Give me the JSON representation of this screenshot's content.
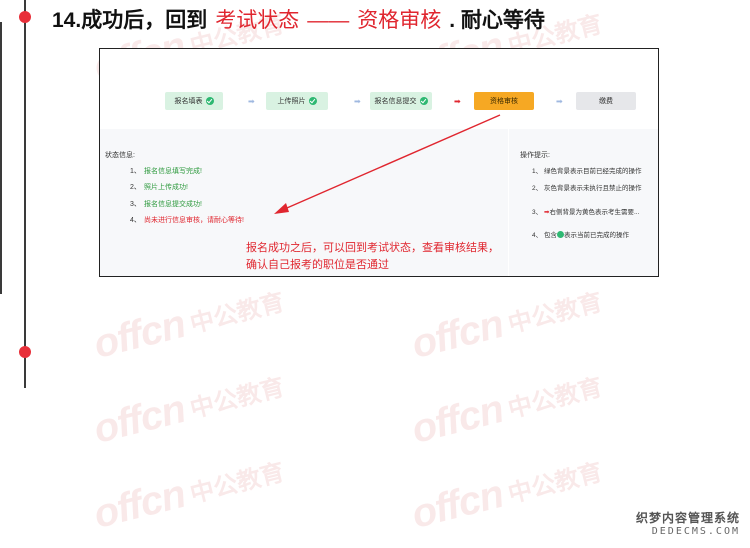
{
  "heading": {
    "prefix": "14.成功后，回到",
    "highlight1": "考试状态",
    "dash": "——",
    "highlight2": "资格审核",
    "suffix": ". 耐心等待"
  },
  "watermark": {
    "latin": "offcn",
    "cn": "中公教育"
  },
  "steps": [
    {
      "label": "报名填表",
      "state": "done"
    },
    {
      "label": "上传照片",
      "state": "done"
    },
    {
      "label": "报名信息提交",
      "state": "done"
    },
    {
      "label": "资格审核",
      "state": "current"
    },
    {
      "label": "缴费",
      "state": "pending"
    }
  ],
  "status": {
    "title": "状态信息:",
    "items": [
      {
        "num": "1、",
        "text": "报名信息填写完成!",
        "tone": "ok"
      },
      {
        "num": "2、",
        "text": "照片上传成功!",
        "tone": "ok"
      },
      {
        "num": "3、",
        "text": "报名信息提交成功!",
        "tone": "ok"
      },
      {
        "num": "4、",
        "text": "尚未进行信息审核，请耐心等待!",
        "tone": "warn"
      }
    ]
  },
  "hints": {
    "title": "操作提示:",
    "items": [
      {
        "num": "1、",
        "text": "绿色背景表示目前已经完成的操作"
      },
      {
        "num": "2、",
        "text": "灰色背景表示未执行且禁止的操作"
      },
      {
        "num": "3、",
        "text": "右侧背景为黄色表示考生需要..."
      },
      {
        "num": "4、",
        "pre": "包含",
        "text": "表示当前已完成的操作"
      }
    ]
  },
  "annotation": {
    "line1": "报名成功之后，可以回到考试状态，查看审核结果，",
    "line2": "确认自己报考的职位是否通过"
  },
  "corner": {
    "name": "织梦内容管理系统",
    "domain": "DEDECMS.COM"
  },
  "colors": {
    "accent": "#e0262f",
    "done": "#d9f2e2",
    "current": "#f6a823",
    "pending": "#e6e7ea"
  }
}
